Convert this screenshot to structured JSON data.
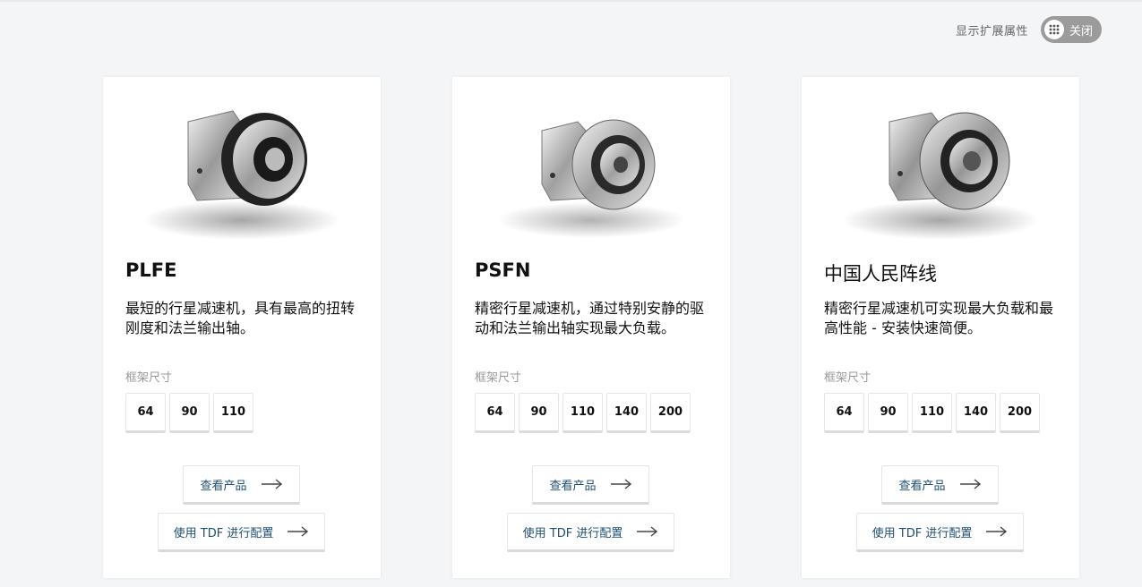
{
  "toolbar": {
    "toggle_label": "显示扩展属性",
    "toggle_state": "关闭"
  },
  "size_label": "框架尺寸",
  "buttons": {
    "view": "查看产品",
    "tdf": "使用 TDF 进行配置"
  },
  "cards": [
    {
      "title": "PLFE",
      "description": "最短的行星减速机，具有最高的扭转刚度和法兰输出轴。",
      "sizes": [
        "64",
        "90",
        "110"
      ]
    },
    {
      "title": "PSFN",
      "description": "精密行星减速机，通过特别安静的驱动和法兰输出轴实现最大负载。",
      "sizes": [
        "64",
        "90",
        "110",
        "140",
        "200"
      ]
    },
    {
      "title": "中国人民阵线",
      "description": "精密行星减速机可实现最大负载和最高性能 - 安装快速简便。",
      "sizes": [
        "64",
        "90",
        "110",
        "140",
        "200"
      ]
    }
  ],
  "colors": {
    "background": "#f4f5f6",
    "accent_text": "#1d4f73",
    "toggle_bg": "#9b9b9b"
  }
}
